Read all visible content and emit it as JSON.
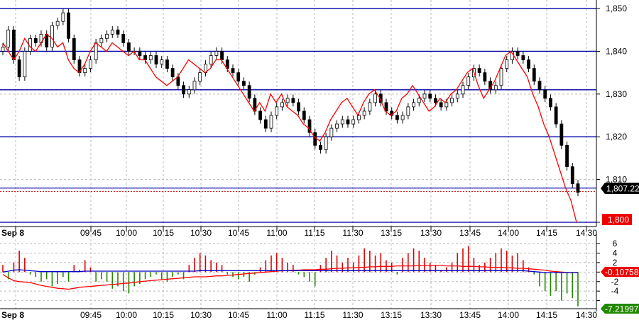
{
  "chart_data": [
    {
      "type": "candlestick",
      "name": "price-panel",
      "x_ticks": [
        "Sep 8",
        "09:45",
        "10:00",
        "10:15",
        "10:30",
        "10:45",
        "11:00",
        "11:15",
        "11:30",
        "13:15",
        "13:30",
        "13:45",
        "14:00",
        "14:15",
        "14:30"
      ],
      "y_ticks": [
        "1,850",
        "1,840",
        "1,830",
        "1,820",
        "1,810",
        "1,800"
      ],
      "ylim": [
        1799,
        1852
      ],
      "grid": true,
      "reference_levels": [
        1850,
        1840,
        1831,
        1820,
        1808,
        1800
      ],
      "dotted_last_level": 1807.22,
      "last_price_label": "1,807.22",
      "red_line_label": "1,800",
      "colors": {
        "candle": "#000000",
        "reference": "#0000aa",
        "red_line": "#ff0000",
        "grid": "#bbbbbb"
      },
      "candles_close": [
        1841,
        1845,
        1838,
        1834,
        1840,
        1843,
        1842,
        1844,
        1841,
        1846,
        1847,
        1849,
        1843,
        1838,
        1835,
        1836,
        1838,
        1842,
        1843,
        1844,
        1845,
        1844,
        1842,
        1840,
        1840,
        1839,
        1838,
        1839,
        1837,
        1838,
        1836,
        1834,
        1832,
        1830,
        1831,
        1833,
        1835,
        1837,
        1839,
        1840,
        1838,
        1836,
        1835,
        1833,
        1832,
        1829,
        1826,
        1824,
        1822,
        1825,
        1827,
        1828,
        1829,
        1828,
        1826,
        1824,
        1821,
        1818,
        1817,
        1820,
        1822,
        1823,
        1824,
        1823,
        1824,
        1825,
        1826,
        1828,
        1830,
        1828,
        1826,
        1825,
        1824,
        1825,
        1827,
        1828,
        1829,
        1830,
        1829,
        1828,
        1827,
        1828,
        1829,
        1830,
        1832,
        1834,
        1836,
        1835,
        1833,
        1831,
        1832,
        1836,
        1838,
        1840,
        1839,
        1838,
        1836,
        1833,
        1831,
        1829,
        1827,
        1823,
        1818,
        1813,
        1809,
        1807
      ],
      "red_line_values": [
        1842,
        1840,
        1838,
        1840,
        1843,
        1841,
        1840,
        1842,
        1844,
        1843,
        1841,
        1842,
        1838,
        1836,
        1835,
        1837,
        1840,
        1842,
        1841,
        1840,
        1842,
        1841,
        1840,
        1839,
        1840,
        1838,
        1838,
        1836,
        1834,
        1833,
        1832,
        1833,
        1834,
        1836,
        1838,
        1837,
        1836,
        1835,
        1836,
        1838,
        1838,
        1836,
        1834,
        1832,
        1830,
        1828,
        1826,
        1828,
        1826,
        1830,
        1828,
        1830,
        1827,
        1826,
        1825,
        1823,
        1822,
        1820,
        1819,
        1821,
        1824,
        1826,
        1828,
        1829,
        1827,
        1825,
        1828,
        1830,
        1831,
        1829,
        1826,
        1825,
        1826,
        1829,
        1830,
        1832,
        1830,
        1828,
        1826,
        1827,
        1829,
        1828,
        1830,
        1831,
        1833,
        1835,
        1836,
        1832,
        1829,
        1831,
        1833,
        1836,
        1839,
        1840,
        1838,
        1836,
        1834,
        1830,
        1827,
        1823,
        1820,
        1816,
        1812,
        1808,
        1805,
        1800
      ]
    },
    {
      "type": "histogram",
      "name": "oscillator-panel",
      "y_ticks": [
        "6",
        "4",
        "2",
        "0",
        "-2",
        "-4",
        "-6"
      ],
      "ylim": [
        -7.4,
        7.2
      ],
      "grid": true,
      "blue_label": "-0.10758",
      "last_value_label": "-7.21997",
      "colors": {
        "positive": "#dd0000",
        "negative": "#228800",
        "signal": "#ff0000",
        "blue": "#0000cc"
      },
      "bars": [
        1.5,
        -1.5,
        2,
        4.5,
        3,
        -0.5,
        -1,
        -2,
        -1.5,
        -3,
        -2.5,
        -1,
        -2,
        1.5,
        0.5,
        2.5,
        1,
        -2,
        -1.5,
        -2,
        -3.5,
        -3,
        -4,
        -4.5,
        -3,
        -2.5,
        -1.5,
        -1,
        -0.5,
        -1.5,
        -2,
        -1,
        -0.5,
        -1.5,
        1.5,
        3,
        4,
        3.5,
        2.5,
        2,
        1.5,
        -0.5,
        -1,
        -1.5,
        -1,
        -2,
        -0.5,
        1,
        2.5,
        3.5,
        4,
        3,
        2,
        1.5,
        -0.5,
        -1,
        -2,
        -3,
        1.5,
        3,
        4.5,
        3.5,
        2,
        3,
        2,
        3.5,
        5,
        4.5,
        3.5,
        4,
        2.5,
        2,
        -0.5,
        3,
        4,
        5,
        4.5,
        3,
        2,
        1.5,
        0.5,
        1,
        2,
        4,
        5,
        5.5,
        3,
        1.5,
        2,
        3,
        4,
        5,
        4.5,
        3.5,
        4,
        2.5,
        1,
        -0.5,
        -3,
        -4,
        -5,
        -4,
        -6,
        -4.5,
        -5.5,
        -7.2
      ],
      "signal_values": [
        -0.5,
        -1.2,
        -1.8,
        -2,
        -2.1,
        -2.2,
        -2.5,
        -2.8,
        -3,
        -3.2,
        -3.4,
        -3.5,
        -3.6,
        -3.4,
        -3.2,
        -3.1,
        -3,
        -2.9,
        -2.8,
        -2.7,
        -2.6,
        -2.5,
        -2.4,
        -2.3,
        -2.2,
        -2,
        -1.9,
        -1.8,
        -1.7,
        -1.6,
        -1.5,
        -1.4,
        -1.3,
        -1.2,
        -1.1,
        -1,
        -1,
        -1,
        -0.9,
        -0.8,
        -0.8,
        -0.7,
        -0.6,
        -0.5,
        -0.4,
        -0.3,
        -0.2,
        -0.1,
        0,
        0.1,
        0.2,
        0.3,
        0.3,
        0.4,
        0.4,
        0.5,
        0.5,
        0.5,
        0.6,
        0.6,
        0.7,
        0.8,
        0.8,
        0.9,
        0.9,
        1,
        1,
        1.1,
        1.1,
        1.2,
        1.2,
        1.2,
        1.3,
        1.3,
        1.3,
        1.3,
        1.4,
        1.4,
        1.4,
        1.4,
        1.4,
        1.3,
        1.3,
        1.3,
        1.2,
        1.2,
        1.2,
        1.1,
        1.1,
        1,
        1,
        1,
        0.9,
        0.9,
        0.8,
        0.8,
        0.7,
        0.6,
        0.5,
        0.4,
        0.2,
        0.1,
        0,
        -0.1,
        -0.1,
        -0.1
      ],
      "blue_values": [
        0,
        0.2,
        0.4,
        0.5,
        0.4,
        0.3,
        0.2,
        0.1,
        0.1,
        0.1,
        0.1,
        0.1,
        0.1,
        0.1,
        0.1,
        0.2,
        0.2,
        0.2,
        0.2,
        0.2,
        0.2,
        0.2,
        0.2,
        0.2,
        0.2,
        0.2,
        0.2,
        0.2,
        0.2,
        0.2,
        0.2,
        0.2,
        0.2,
        0.2,
        0.2,
        0.2,
        0.3,
        0.3,
        0.3,
        0.3,
        0.3,
        0.3,
        0.3,
        0.3,
        0.3,
        0.3,
        0.3,
        0.3,
        0.3,
        0.3,
        0.3,
        0.3,
        0.3,
        0.3,
        0.3,
        0.3,
        0.3,
        0.3,
        0.3,
        0.3,
        0.3,
        0.3,
        0.3,
        0.3,
        0.3,
        0.3,
        0.3,
        0.3,
        0.3,
        0.3,
        0.3,
        0.3,
        0.3,
        0.3,
        0.3,
        0.3,
        0.3,
        0.3,
        0.3,
        0.3,
        0.3,
        0.3,
        0.3,
        0.3,
        0.3,
        0.3,
        0.3,
        0.3,
        0.3,
        0.3,
        0.3,
        0.3,
        0.3,
        0.3,
        0.3,
        0.3,
        0.2,
        0.1,
        0,
        -0.1,
        -0.1,
        -0.1,
        -0.1,
        -0.1,
        -0.1,
        -0.1
      ]
    }
  ]
}
